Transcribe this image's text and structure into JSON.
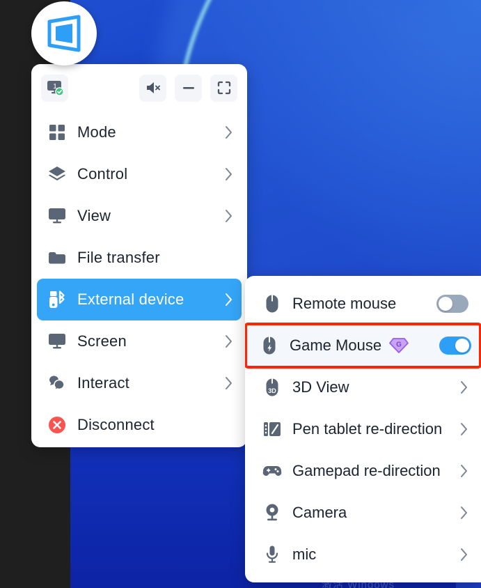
{
  "app": {
    "logo_icon": "screen-cast-logo-icon"
  },
  "toolbar": {
    "monitor_button": {
      "icon": "monitor-connected-icon",
      "badge_number": "1",
      "status": "connected"
    },
    "mute_button": {
      "icon": "speaker-mute-icon",
      "label": "Mute"
    },
    "minimize_button": {
      "icon": "minimize-icon",
      "label": "Minimize"
    },
    "fullscreen_button": {
      "icon": "fullscreen-icon",
      "label": "Fullscreen"
    }
  },
  "menu": {
    "items": [
      {
        "label": "Mode",
        "icon": "grid-squares-icon",
        "has_arrow": true,
        "active": false
      },
      {
        "label": "Control",
        "icon": "layers-icon",
        "has_arrow": true,
        "active": false
      },
      {
        "label": "View",
        "icon": "monitor-icon",
        "has_arrow": true,
        "active": false
      },
      {
        "label": "File transfer",
        "icon": "folder-icon",
        "has_arrow": false,
        "active": false
      },
      {
        "label": "External device",
        "icon": "usb-bluetooth-icon",
        "has_arrow": true,
        "active": true
      },
      {
        "label": "Screen",
        "icon": "monitor-icon",
        "has_arrow": true,
        "active": false
      },
      {
        "label": "Interact",
        "icon": "chat-bubbles-icon",
        "has_arrow": true,
        "active": false
      },
      {
        "label": "Disconnect",
        "icon": "disconnect-x-icon",
        "has_arrow": false,
        "active": false
      }
    ]
  },
  "submenu": {
    "items": [
      {
        "label": "Remote mouse",
        "icon": "mouse-icon",
        "control": "toggle",
        "toggle_on": false,
        "badge": null,
        "highlighted": false
      },
      {
        "label": "Game Mouse",
        "icon": "game-mouse-icon",
        "control": "toggle",
        "toggle_on": true,
        "badge": "G",
        "badge_color": "#9b5de5",
        "highlighted": true
      },
      {
        "label": "3D View",
        "icon": "mouse-3d-icon",
        "control": "arrow",
        "toggle_on": null,
        "badge": null,
        "highlighted": false
      },
      {
        "label": "Pen tablet re-direction",
        "icon": "pen-tablet-icon",
        "control": "arrow",
        "toggle_on": null,
        "badge": null,
        "highlighted": false
      },
      {
        "label": "Gamepad re-direction",
        "icon": "gamepad-icon",
        "control": "arrow",
        "toggle_on": null,
        "badge": null,
        "highlighted": false
      },
      {
        "label": "Camera",
        "icon": "camera-icon",
        "control": "arrow",
        "toggle_on": null,
        "badge": null,
        "highlighted": false
      },
      {
        "label": "mic",
        "icon": "microphone-icon",
        "control": "arrow",
        "toggle_on": null,
        "badge": null,
        "highlighted": false
      }
    ]
  },
  "desktop": {
    "watermark": "激活 Windows",
    "wallpaper": "blue-bloom-wallpaper"
  },
  "colors": {
    "accent_blue": "#35a5f7",
    "toggle_on": "#2e9ff7",
    "toggle_off": "#9aa8bc",
    "highlight_border": "#fe2500",
    "icon_gray": "#5a6575",
    "disconnect_red": "#f9544f",
    "status_green": "#3cc97c",
    "badge_purple": "#9b5de5",
    "wallpaper_blue": "#1036bf"
  }
}
